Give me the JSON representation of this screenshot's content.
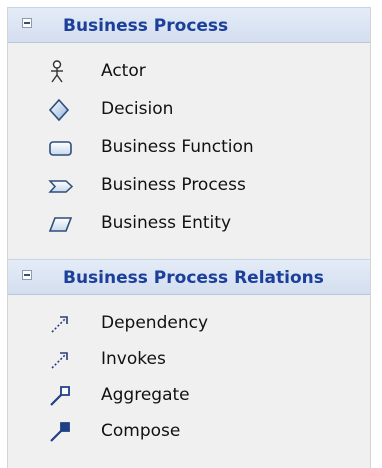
{
  "groups": [
    {
      "title": "Business Process",
      "items": [
        {
          "label": "Actor",
          "icon": "actor-icon"
        },
        {
          "label": "Decision",
          "icon": "decision-icon"
        },
        {
          "label": "Business Function",
          "icon": "business-function-icon"
        },
        {
          "label": "Business Process",
          "icon": "business-process-icon"
        },
        {
          "label": "Business Entity",
          "icon": "business-entity-icon"
        }
      ]
    },
    {
      "title": "Business Process Relations",
      "items": [
        {
          "label": "Dependency",
          "icon": "dependency-icon"
        },
        {
          "label": "Invokes",
          "icon": "invokes-icon"
        },
        {
          "label": "Aggregate",
          "icon": "aggregate-icon"
        },
        {
          "label": "Compose",
          "icon": "compose-icon"
        }
      ]
    }
  ],
  "colors": {
    "header_text": "#1b3f9a",
    "header_bg": "#d9e3f2",
    "panel_bg": "#f0f0f0"
  }
}
